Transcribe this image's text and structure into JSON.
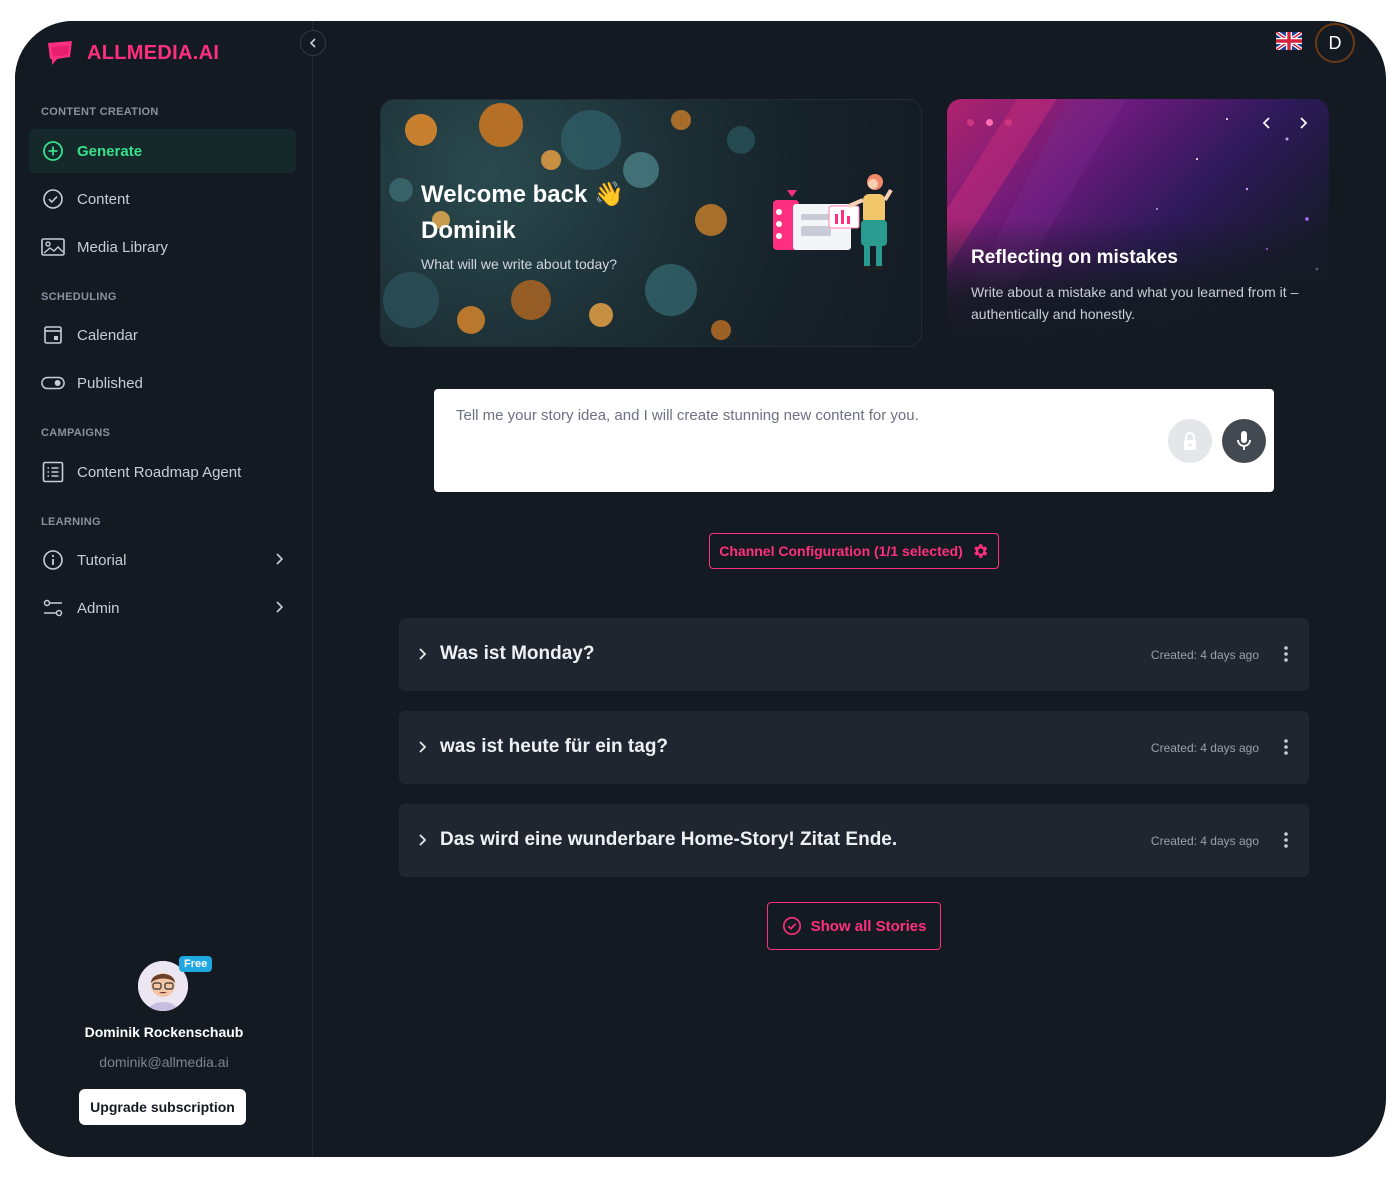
{
  "brand": {
    "name": "ALLMEDIA.AI",
    "accent": "#ff2f7f"
  },
  "sidebar": {
    "sections": [
      {
        "title": "CONTENT CREATION"
      },
      {
        "title": "SCHEDULING"
      },
      {
        "title": "CAMPAIGNS"
      },
      {
        "title": "LEARNING"
      }
    ],
    "items": [
      {
        "label": "Generate",
        "icon": "plus-circle-icon",
        "active": true
      },
      {
        "label": "Content",
        "icon": "check-circle-icon"
      },
      {
        "label": "Media Library",
        "icon": "image-icon"
      },
      {
        "label": "Calendar",
        "icon": "calendar-icon"
      },
      {
        "label": "Published",
        "icon": "toggle-icon"
      },
      {
        "label": "Content Roadmap Agent",
        "icon": "list-icon"
      },
      {
        "label": "Tutorial",
        "icon": "info-icon"
      },
      {
        "label": "Admin",
        "icon": "settings-sliders-icon"
      }
    ]
  },
  "profile": {
    "badge": "Free",
    "name": "Dominik Rockenschaub",
    "email": "dominik@allmedia.ai",
    "upgrade_label": "Upgrade subscription"
  },
  "header": {
    "user_initial": "D",
    "language_icon": "uk-flag-icon"
  },
  "welcome": {
    "line1": "Welcome back 👋",
    "line2": "Dominik",
    "subtitle": "What will we write about today?"
  },
  "inspiration": {
    "title": "Reflecting on mistakes",
    "text": "Write about a mistake and what you learned from it –authentically and honestly."
  },
  "prompt": {
    "placeholder": "Tell me your story idea, and I will create stunning new content for you."
  },
  "channel_config": {
    "label": "Channel Configuration (1/1 selected)"
  },
  "stories": [
    {
      "title": "Was ist Monday?",
      "created": "Created: 4 days ago"
    },
    {
      "title": "was ist heute für ein tag?",
      "created": "Created: 4 days ago"
    },
    {
      "title": "Das wird eine wunderbare Home-Story! Zitat Ende.",
      "created": "Created: 4 days ago"
    }
  ],
  "show_all_label": "Show all Stories"
}
